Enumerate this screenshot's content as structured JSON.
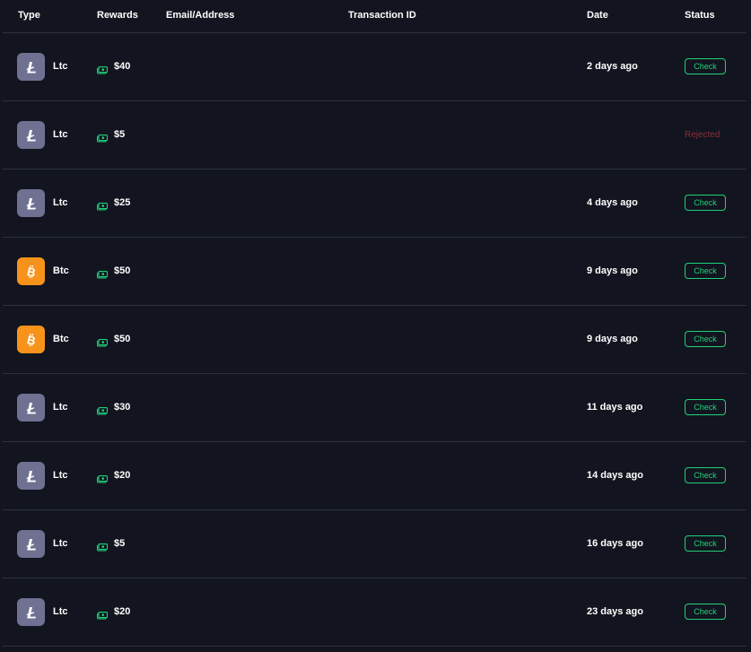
{
  "columns": {
    "type": "Type",
    "rewards": "Rewards",
    "email": "Email/Address",
    "txid": "Transaction ID",
    "date": "Date",
    "status": "Status"
  },
  "colors": {
    "ltc_icon_bg": "#6e7191",
    "btc_icon_bg": "#f7931a",
    "check_green": "#1fd17a",
    "rejected_red": "#8a2f36",
    "cash_green": "#1fd17a"
  },
  "rows": [
    {
      "coin": "ltc",
      "type": "Ltc",
      "reward": "$40",
      "date": "2 days ago",
      "status": "check",
      "status_label": "Check"
    },
    {
      "coin": "ltc",
      "type": "Ltc",
      "reward": "$5",
      "date": "",
      "status": "rejected",
      "status_label": "Rejected"
    },
    {
      "coin": "ltc",
      "type": "Ltc",
      "reward": "$25",
      "date": "4 days ago",
      "status": "check",
      "status_label": "Check"
    },
    {
      "coin": "btc",
      "type": "Btc",
      "reward": "$50",
      "date": "9 days ago",
      "status": "check",
      "status_label": "Check"
    },
    {
      "coin": "btc",
      "type": "Btc",
      "reward": "$50",
      "date": "9 days ago",
      "status": "check",
      "status_label": "Check"
    },
    {
      "coin": "ltc",
      "type": "Ltc",
      "reward": "$30",
      "date": "11 days ago",
      "status": "check",
      "status_label": "Check"
    },
    {
      "coin": "ltc",
      "type": "Ltc",
      "reward": "$20",
      "date": "14 days ago",
      "status": "check",
      "status_label": "Check"
    },
    {
      "coin": "ltc",
      "type": "Ltc",
      "reward": "$5",
      "date": "16 days ago",
      "status": "check",
      "status_label": "Check"
    },
    {
      "coin": "ltc",
      "type": "Ltc",
      "reward": "$20",
      "date": "23 days ago",
      "status": "check",
      "status_label": "Check"
    }
  ]
}
